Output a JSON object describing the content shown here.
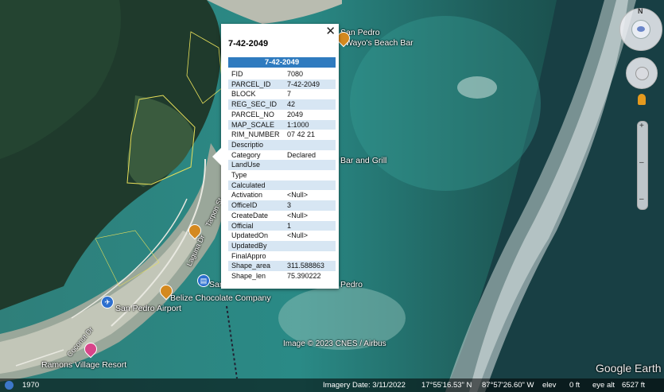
{
  "map_labels": {
    "san_pedro_top": "San Pedro",
    "wayos": "Wayo's Beach Bar",
    "bar_grill": "Bar and Grill",
    "pedro": "Pedro",
    "san_short": "San",
    "airport": "San Pedro Airport",
    "chocolate": "Belize Chocolate Company",
    "ramons": "Ramons Village Resort",
    "coconut": "Coconut Dr",
    "tarpon": "Tarpon St",
    "laguna": "Laguna Dr"
  },
  "attribution": "Image © 2023 CNES / Airbus",
  "google_earth": "Google Earth",
  "popup": {
    "title": "7-42-2049",
    "header": "7-42-2049",
    "close": "✕",
    "rows": [
      {
        "k": "FID",
        "v": "7080"
      },
      {
        "k": "PARCEL_ID",
        "v": "7-42-2049"
      },
      {
        "k": "BLOCK",
        "v": "7"
      },
      {
        "k": "REG_SEC_ID",
        "v": "42"
      },
      {
        "k": "PARCEL_NO",
        "v": "2049"
      },
      {
        "k": "MAP_SCALE",
        "v": "1:1000"
      },
      {
        "k": "RIM_NUMBER",
        "v": "07 42 21"
      },
      {
        "k": "Descriptio",
        "v": ""
      },
      {
        "k": "Category",
        "v": "Declared"
      },
      {
        "k": "LandUse",
        "v": ""
      },
      {
        "k": "Type",
        "v": ""
      },
      {
        "k": "Calculated",
        "v": ""
      },
      {
        "k": "Activation",
        "v": "<Null>"
      },
      {
        "k": "OfficeID",
        "v": "3"
      },
      {
        "k": "CreateDate",
        "v": "<Null>"
      },
      {
        "k": "Official",
        "v": "1"
      },
      {
        "k": "UpdatedOn",
        "v": "<Null>"
      },
      {
        "k": "UpdatedBy",
        "v": ""
      },
      {
        "k": "FinalAppro",
        "v": ""
      },
      {
        "k": "Shape_area",
        "v": "311.588863"
      },
      {
        "k": "Shape_len",
        "v": "75.390222"
      }
    ]
  },
  "status": {
    "year": "1970",
    "imagery_date": "Imagery Date: 3/11/2022",
    "lat": "17°55'16.53\" N",
    "lon": "87°57'26.60\" W",
    "elev_label": "elev",
    "elev": "0 ft",
    "eye_label": "eye alt",
    "eye": "6527 ft"
  },
  "nav": {
    "north": "N"
  },
  "colors": {
    "header": "#2f7bbf",
    "row_alt": "#d7e6f3"
  }
}
